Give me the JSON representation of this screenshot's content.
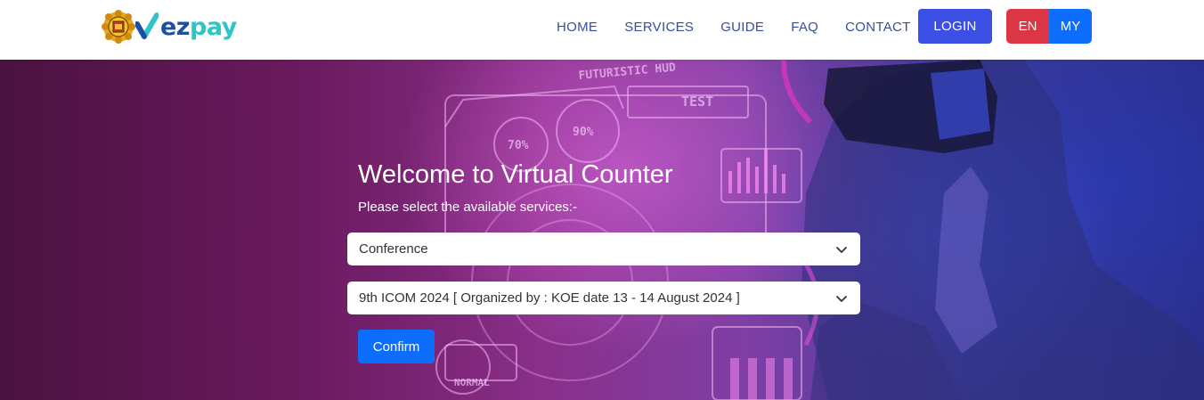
{
  "brand": {
    "name_part1": "ez",
    "name_part2": "pay",
    "accent_dark": "#1f4fa0",
    "accent_light": "#2ec5c9"
  },
  "nav": {
    "items": [
      {
        "label": "HOME"
      },
      {
        "label": "SERVICES"
      },
      {
        "label": "GUIDE"
      },
      {
        "label": "FAQ"
      },
      {
        "label": "CONTACT"
      }
    ],
    "login_label": "LOGIN",
    "lang_en": "EN",
    "lang_my": "MY"
  },
  "hero": {
    "title": "Welcome to Virtual Counter",
    "subtitle": "Please select the available services:-",
    "service_select": {
      "value": "Conference"
    },
    "event_select": {
      "value": "9th ICOM 2024 [ Organized by : KOE date 13 - 14 August 2024 ]"
    },
    "confirm_label": "Confirm"
  },
  "background_text": {
    "hud_label": "FUTURISTIC HUD",
    "test_label": "TEST",
    "pct_1": "70%",
    "pct_2": "90%",
    "normal_label": "NORMAL"
  },
  "colors": {
    "login": "#3b4fe4",
    "lang_en": "#dc3545",
    "lang_my": "#0d6efd",
    "confirm": "#0d6efd",
    "nav_text": "#34509c"
  },
  "icons": {
    "logo_emblem": "state-crest-icon",
    "logo_mark": "check-v-icon",
    "select_chevron": "chevron-down-icon"
  }
}
